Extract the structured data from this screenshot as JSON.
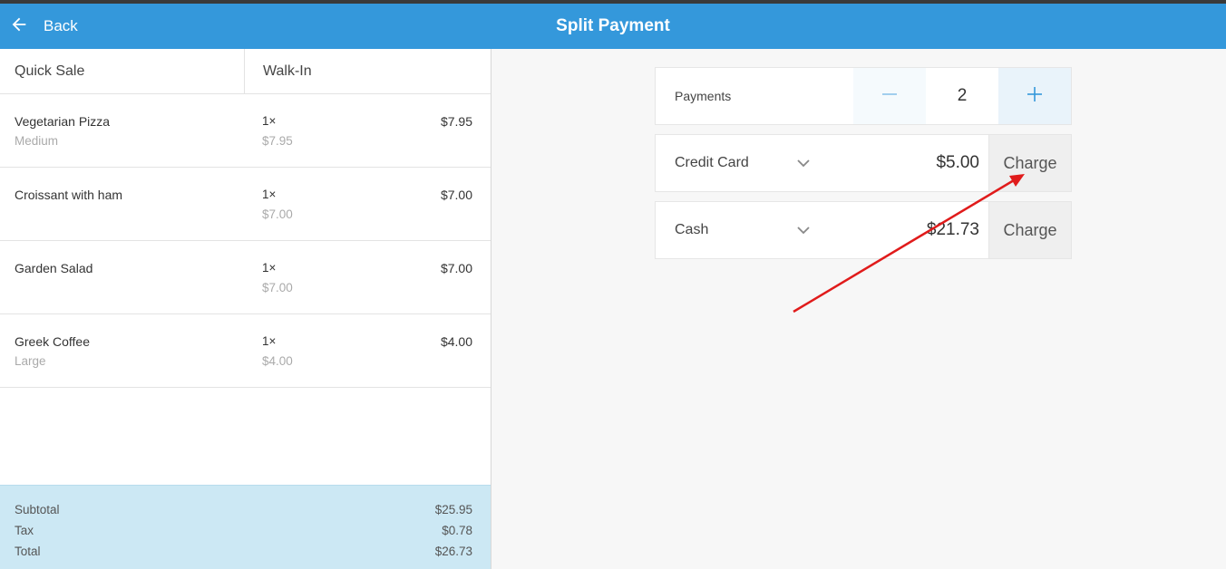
{
  "header": {
    "back_label": "Back",
    "title": "Split Payment"
  },
  "order": {
    "sale_type": "Quick Sale",
    "customer": "Walk-In",
    "items": [
      {
        "name": "Vegetarian Pizza",
        "modifier": "Medium",
        "qty": "1×",
        "unit_price": "$7.95",
        "price": "$7.95"
      },
      {
        "name": "Croissant with ham",
        "modifier": "",
        "qty": "1×",
        "unit_price": "$7.00",
        "price": "$7.00"
      },
      {
        "name": "Garden Salad",
        "modifier": "",
        "qty": "1×",
        "unit_price": "$7.00",
        "price": "$7.00"
      },
      {
        "name": "Greek Coffee",
        "modifier": "Large",
        "qty": "1×",
        "unit_price": "$4.00",
        "price": "$4.00"
      }
    ],
    "totals": {
      "subtotal_label": "Subtotal",
      "subtotal": "$25.95",
      "tax_label": "Tax",
      "tax": "$0.78",
      "total_label": "Total",
      "total": "$26.73"
    }
  },
  "payments": {
    "label": "Payments",
    "count": "2",
    "rows": [
      {
        "method": "Credit Card",
        "amount": "$5.00",
        "charge_label": "Charge"
      },
      {
        "method": "Cash",
        "amount": "$21.73",
        "charge_label": "Charge"
      }
    ]
  },
  "colors": {
    "header_bg": "#3498db",
    "totals_bg": "#cce8f4",
    "stepper_icon": "#3498db",
    "annotation_arrow": "#e01b1b"
  },
  "icons": {
    "back": "arrow-left-icon",
    "minus": "minus-icon",
    "plus": "plus-icon",
    "dropdown": "chevron-down-icon"
  }
}
